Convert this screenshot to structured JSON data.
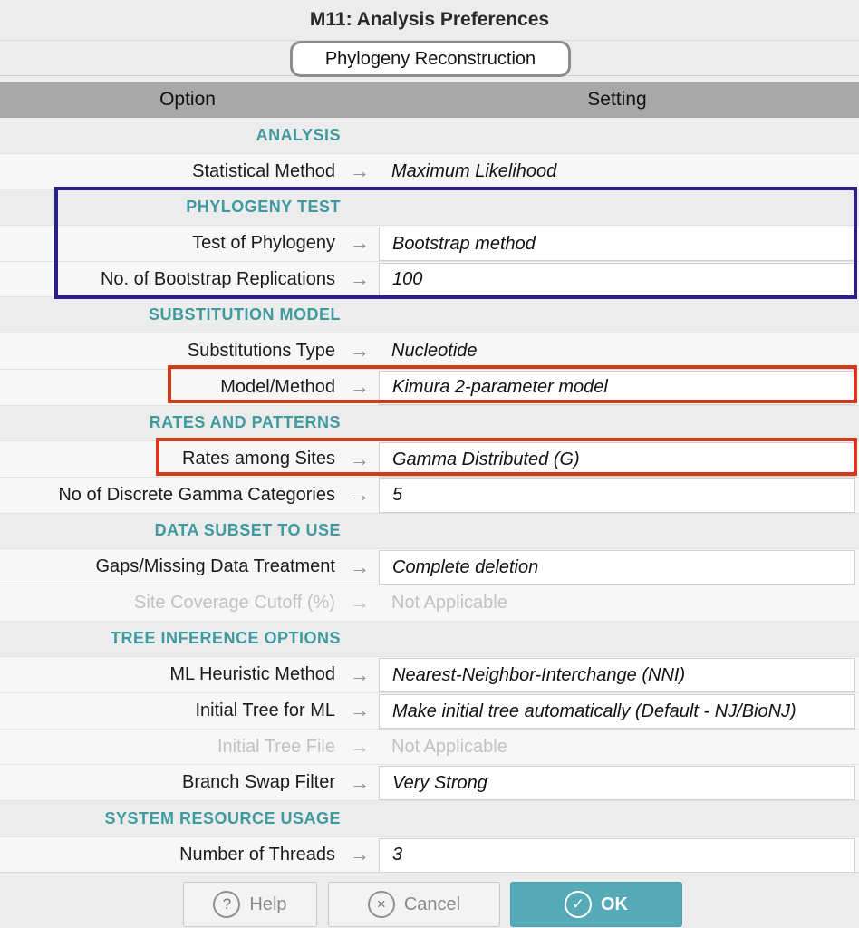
{
  "window": {
    "title": "M11: Analysis Preferences"
  },
  "tab": {
    "label": "Phylogeny Reconstruction"
  },
  "grid": {
    "option_header": "Option",
    "setting_header": "Setting"
  },
  "sections": {
    "analysis": "ANALYSIS",
    "phylogeny_test": "PHYLOGENY TEST",
    "substitution_model": "SUBSTITUTION MODEL",
    "rates_patterns": "RATES AND PATTERNS",
    "data_subset": "DATA SUBSET TO USE",
    "tree_inference": "TREE INFERENCE OPTIONS",
    "system_resource": "SYSTEM RESOURCE USAGE"
  },
  "options": {
    "statistical_method": {
      "label": "Statistical Method",
      "value": "Maximum Likelihood"
    },
    "test_of_phylogeny": {
      "label": "Test of Phylogeny",
      "value": "Bootstrap method"
    },
    "bootstrap_replications": {
      "label": "No. of Bootstrap Replications",
      "value": "100"
    },
    "substitutions_type": {
      "label": "Substitutions Type",
      "value": "Nucleotide"
    },
    "model_method": {
      "label": "Model/Method",
      "value": "Kimura 2-parameter model"
    },
    "rates_among_sites": {
      "label": "Rates among Sites",
      "value": "Gamma Distributed (G)"
    },
    "gamma_categories": {
      "label": "No of Discrete Gamma Categories",
      "value": "5"
    },
    "gaps_missing": {
      "label": "Gaps/Missing Data Treatment",
      "value": "Complete deletion"
    },
    "site_coverage": {
      "label": "Site Coverage Cutoff (%)",
      "value": "Not Applicable"
    },
    "ml_heuristic": {
      "label": "ML Heuristic Method",
      "value": "Nearest-Neighbor-Interchange (NNI)"
    },
    "initial_tree_ml": {
      "label": "Initial Tree for ML",
      "value": "Make initial tree automatically (Default - NJ/BioNJ)"
    },
    "initial_tree_file": {
      "label": "Initial Tree File",
      "value": "Not Applicable"
    },
    "branch_swap": {
      "label": "Branch Swap Filter",
      "value": "Very Strong"
    },
    "threads": {
      "label": "Number of Threads",
      "value": "3"
    }
  },
  "arrow_glyph": "→",
  "buttons": {
    "help": {
      "label": "Help",
      "icon": "?"
    },
    "cancel": {
      "label": "Cancel",
      "icon": "×"
    },
    "ok": {
      "label": "OK",
      "icon": "✓"
    }
  },
  "colors": {
    "section_text": "#3f9aa0",
    "ok_button": "#55aab8",
    "highlight_blue": "#2c1f8c",
    "highlight_red": "#d5391b"
  }
}
